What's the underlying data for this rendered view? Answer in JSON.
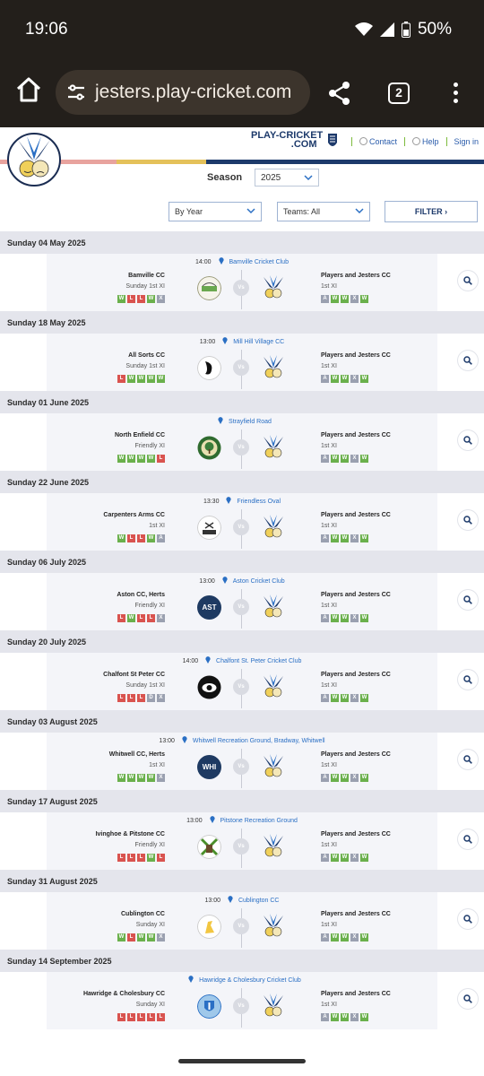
{
  "status": {
    "time": "19:06",
    "battery": "50%"
  },
  "browser": {
    "url": "jesters.play-cricket.com",
    "tab_count": "2"
  },
  "header": {
    "brand_line1": "PLAY-CRICKET",
    "brand_line2": ".COM",
    "links": {
      "contact": "Contact",
      "help": "Help",
      "signin": "Sign in"
    },
    "season_label": "Season",
    "season_value": "2025"
  },
  "filters": {
    "by_year": "By Year",
    "teams": "Teams: All",
    "filter_button": "FILTER"
  },
  "fixtures": [
    {
      "date": "Sunday 04 May 2025",
      "time": "14:00",
      "venue": "Bamville Cricket Club",
      "home": "Bamville CC",
      "home_team": "Sunday 1st XI",
      "home_form": [
        "W",
        "L",
        "L",
        "W",
        "X"
      ],
      "badge": "bamville",
      "away": "Players and Jesters CC",
      "away_team": "1st XI",
      "away_form": [
        "A",
        "W",
        "W",
        "X",
        "W"
      ]
    },
    {
      "date": "Sunday 18 May 2025",
      "time": "13:00",
      "venue": "Mill Hill Village CC",
      "home": "All Sorts CC",
      "home_team": "Sunday 1st XI",
      "home_form": [
        "L",
        "W",
        "W",
        "W",
        "W"
      ],
      "badge": "allsorts",
      "away": "Players and Jesters CC",
      "away_team": "1st XI",
      "away_form": [
        "A",
        "W",
        "W",
        "X",
        "W"
      ]
    },
    {
      "date": "Sunday 01 June 2025",
      "time": "",
      "venue": "Strayfield Road",
      "home": "North Enfield CC",
      "home_team": "Friendly XI",
      "home_form": [
        "W",
        "W",
        "W",
        "W",
        "L"
      ],
      "badge": "enfield",
      "away": "Players and Jesters CC",
      "away_team": "1st XI",
      "away_form": [
        "A",
        "W",
        "W",
        "X",
        "W"
      ]
    },
    {
      "date": "Sunday 22 June 2025",
      "time": "13:30",
      "venue": "Friendless Oval",
      "home": "Carpenters Arms CC",
      "home_team": "1st XI",
      "home_form": [
        "W",
        "L",
        "L",
        "W",
        "A"
      ],
      "badge": "carpenters",
      "away": "Players and Jesters CC",
      "away_team": "1st XI",
      "away_form": [
        "A",
        "W",
        "W",
        "X",
        "W"
      ]
    },
    {
      "date": "Sunday 06 July 2025",
      "time": "13:00",
      "venue": "Aston Cricket Club",
      "home": "Aston CC, Herts",
      "home_team": "Friendly XI",
      "home_form": [
        "L",
        "W",
        "L",
        "L",
        "X"
      ],
      "badge": "text",
      "badge_text": "AST",
      "away": "Players and Jesters CC",
      "away_team": "1st XI",
      "away_form": [
        "A",
        "W",
        "W",
        "X",
        "W"
      ]
    },
    {
      "date": "Sunday 20 July 2025",
      "time": "14:00",
      "venue": "Chalfont St. Peter Cricket Club",
      "home": "Chalfont St Peter CC",
      "home_team": "Sunday 1st XI",
      "home_form": [
        "L",
        "L",
        "L",
        "D",
        "X"
      ],
      "badge": "chalfont",
      "away": "Players and Jesters CC",
      "away_team": "1st XI",
      "away_form": [
        "A",
        "W",
        "W",
        "X",
        "W"
      ]
    },
    {
      "date": "Sunday 03 August 2025",
      "time": "13:00",
      "venue": "Whitwell Recreation Ground, Bradway, Whitwell",
      "home": "Whitwell CC, Herts",
      "home_team": "1st XI",
      "home_form": [
        "W",
        "W",
        "W",
        "W",
        "X"
      ],
      "badge": "text",
      "badge_text": "WHI",
      "away": "Players and Jesters CC",
      "away_team": "1st XI",
      "away_form": [
        "A",
        "W",
        "W",
        "X",
        "W"
      ]
    },
    {
      "date": "Sunday 17 August 2025",
      "time": "13:00",
      "venue": "Pitstone Recreation Ground",
      "home": "Ivinghoe & Pitstone CC",
      "home_team": "Friendly XI",
      "home_form": [
        "L",
        "L",
        "L",
        "W",
        "L"
      ],
      "badge": "ivinghoe",
      "away": "Players and Jesters CC",
      "away_team": "1st XI",
      "away_form": [
        "A",
        "W",
        "W",
        "X",
        "W"
      ]
    },
    {
      "date": "Sunday 31 August 2025",
      "time": "13:00",
      "venue": "Cublington CC",
      "home": "Cublington CC",
      "home_team": "Sunday XI",
      "home_form": [
        "W",
        "L",
        "W",
        "W",
        "X"
      ],
      "badge": "cublington",
      "away": "Players and Jesters CC",
      "away_team": "1st XI",
      "away_form": [
        "A",
        "W",
        "W",
        "X",
        "W"
      ]
    },
    {
      "date": "Sunday 14 September 2025",
      "time": "",
      "venue": "Hawridge & Cholesbury Cricket Club",
      "home": "Hawridge & Cholesbury CC",
      "home_team": "Sunday XI",
      "home_form": [
        "L",
        "L",
        "L",
        "L",
        "L"
      ],
      "badge": "hawridge",
      "away": "Players and Jesters CC",
      "away_team": "1st XI",
      "away_form": [
        "A",
        "W",
        "W",
        "X",
        "W"
      ]
    }
  ],
  "colors": {
    "win": "#6ab04c",
    "loss": "#d9534f",
    "neutral": "#9aa0b0",
    "link": "#2a6fc4",
    "navy": "#1d3a6b"
  }
}
